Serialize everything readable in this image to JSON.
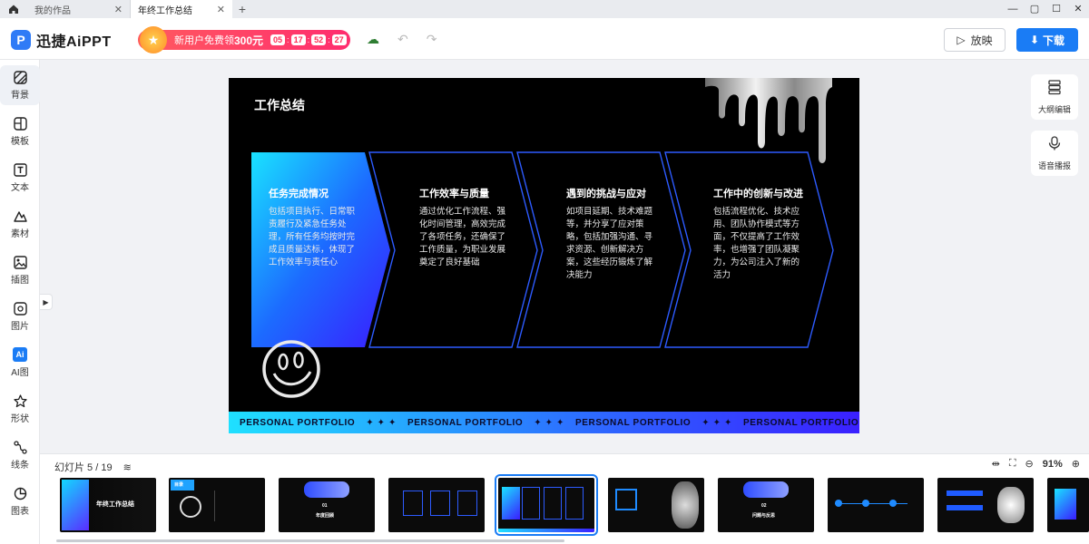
{
  "tabs": [
    {
      "label": "我的作品",
      "active": false
    },
    {
      "label": "年终工作总结",
      "active": true
    }
  ],
  "window": {
    "minimize": "—",
    "restore": "▢",
    "maximize": "☐",
    "close": "✕"
  },
  "header": {
    "app_name": "迅捷AiPPT",
    "promo_text": "新用户免费领",
    "promo_amount": "300元",
    "timer": [
      "05",
      "17",
      "52",
      "27"
    ],
    "play_label": "放映",
    "download_label": "下载",
    "colors": {
      "accent": "#1a7cf5",
      "promo": "#ff2d6f"
    }
  },
  "sidebar": {
    "items": [
      {
        "label": "背景",
        "icon": "background-icon"
      },
      {
        "label": "模板",
        "icon": "template-icon"
      },
      {
        "label": "文本",
        "icon": "text-icon"
      },
      {
        "label": "素材",
        "icon": "material-icon"
      },
      {
        "label": "插图",
        "icon": "illustration-icon"
      },
      {
        "label": "图片",
        "icon": "image-icon"
      },
      {
        "label": "AI图",
        "icon": "ai-image-icon"
      },
      {
        "label": "形状",
        "icon": "shape-icon"
      },
      {
        "label": "线条",
        "icon": "line-icon"
      },
      {
        "label": "图表",
        "icon": "chart-icon"
      }
    ]
  },
  "right_tools": [
    {
      "label": "大纲编辑",
      "icon": "outline-icon"
    },
    {
      "label": "语音播报",
      "icon": "microphone-icon"
    }
  ],
  "slide": {
    "title": "工作总结",
    "cards": [
      {
        "title": "任务完成情况",
        "body": "包括项目执行、日常职责履行及紧急任务处理，所有任务均按时完成且质量达标，体现了工作效率与责任心"
      },
      {
        "title": "工作效率与质量",
        "body": "通过优化工作流程、强化时间管理，高效完成了各项任务，还确保了工作质量，为职业发展奠定了良好基础"
      },
      {
        "title": "遇到的挑战与应对",
        "body": "如项目延期、技术难题等，并分享了应对策略，包括加强沟通、寻求资源、创新解决方案，这些经历锻炼了解决能力"
      },
      {
        "title": "工作中的创新与改进",
        "body": "包括流程优化、技术应用、团队协作模式等方面，不仅提高了工作效率，也增强了团队凝聚力，为公司注入了新的活力"
      }
    ],
    "footer_text": "PERSONAL PORTFOLIO",
    "footer_stars": "✦ ✦ ✦"
  },
  "filmstrip": {
    "label": "幻灯片 5 / 19",
    "zoom": "91%",
    "current": 5,
    "thumbs": [
      {
        "title": "年终工作总结"
      },
      {
        "title": "目录"
      },
      {
        "title": "年度回顾",
        "num": "01"
      },
      {
        "title": ""
      },
      {
        "title": ""
      },
      {
        "title": ""
      },
      {
        "title": "问题与反思",
        "num": "02"
      },
      {
        "title": ""
      },
      {
        "title": ""
      },
      {
        "title": ""
      }
    ]
  }
}
